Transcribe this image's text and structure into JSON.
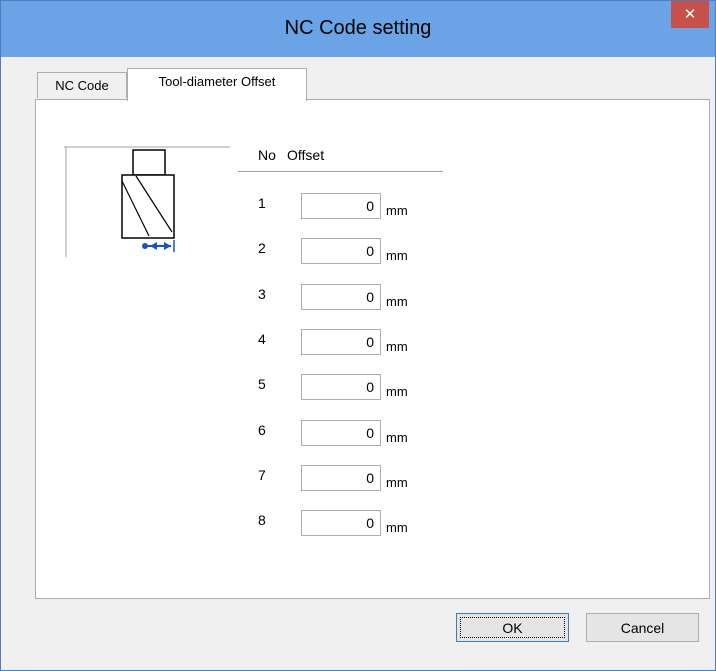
{
  "window": {
    "title": "NC Code setting",
    "close_glyph": "✕"
  },
  "tabs": [
    {
      "label": "NC Code",
      "active": false
    },
    {
      "label": "Tool-diameter Offset",
      "active": true
    }
  ],
  "table": {
    "headers": {
      "no": "No",
      "offset": "Offset"
    },
    "unit": "mm",
    "rows": [
      {
        "no": "1",
        "value": "0"
      },
      {
        "no": "2",
        "value": "0"
      },
      {
        "no": "3",
        "value": "0"
      },
      {
        "no": "4",
        "value": "0"
      },
      {
        "no": "5",
        "value": "0"
      },
      {
        "no": "6",
        "value": "0"
      },
      {
        "no": "7",
        "value": "0"
      },
      {
        "no": "8",
        "value": "0"
      }
    ]
  },
  "buttons": {
    "ok": "OK",
    "cancel": "Cancel"
  },
  "colors": {
    "titlebar": "#6aa4e6",
    "close": "#c7504a",
    "arrow": "#1a4fd1"
  },
  "icons": {
    "diagram": "tool-diameter-offset-icon"
  }
}
